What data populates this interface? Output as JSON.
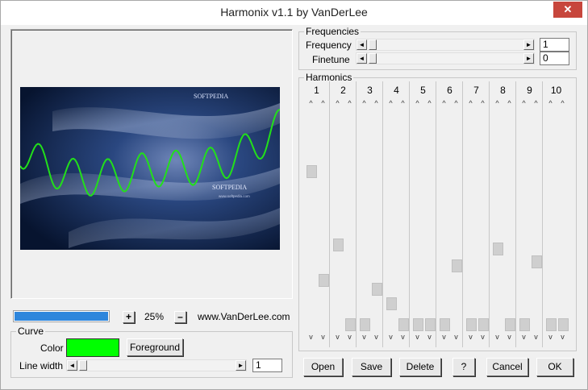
{
  "window": {
    "title": "Harmonix v1.1 by VanDerLee",
    "close_label": "✕"
  },
  "preview": {
    "watermark_1": "SOFTPEDIA",
    "watermark_2": "SOFTPEDIA",
    "watermark_3": "www.softpedia.com",
    "curve_color": "#22e01a"
  },
  "zoom": {
    "progress": 1.0,
    "plus_label": "+",
    "value": "25%",
    "minus_label": "–",
    "website": "www.VanDerLee.com"
  },
  "curve": {
    "group_title": "Curve",
    "color_label": "Color",
    "color_value": "#00ff00",
    "foreground_button": "Foreground",
    "linewidth_label": "Line width",
    "linewidth_value": "1"
  },
  "frequencies": {
    "group_title": "Frequencies",
    "frequency_label": "Frequency",
    "frequency_value": "1",
    "finetune_label": "Finetune",
    "finetune_value": "0"
  },
  "harmonics": {
    "group_title": "Harmonics",
    "columns": [
      {
        "label": "1",
        "left": 0.27,
        "right": 0.79
      },
      {
        "label": "2",
        "left": 0.62,
        "right": 1.0
      },
      {
        "label": "3",
        "left": 1.0,
        "right": 0.83
      },
      {
        "label": "4",
        "left": 0.9,
        "right": 1.0
      },
      {
        "label": "5",
        "left": 1.0,
        "right": 1.0
      },
      {
        "label": "6",
        "left": 1.0,
        "right": 0.72
      },
      {
        "label": "7",
        "left": 1.0,
        "right": 1.0
      },
      {
        "label": "8",
        "left": 0.64,
        "right": 1.0
      },
      {
        "label": "9",
        "left": 1.0,
        "right": 0.7
      },
      {
        "label": "10",
        "left": 1.0,
        "right": 1.0
      }
    ]
  },
  "buttons": {
    "open": "Open",
    "save": "Save",
    "delete": "Delete",
    "help": "?",
    "cancel": "Cancel",
    "ok": "OK"
  }
}
